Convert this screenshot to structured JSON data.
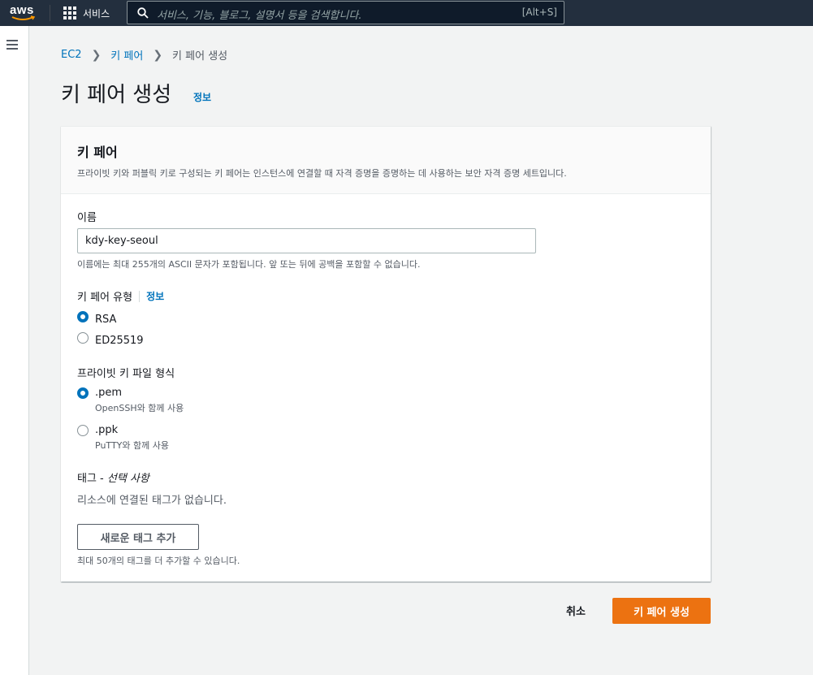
{
  "nav": {
    "logo": "aws",
    "services_label": "서비스",
    "search_placeholder": "서비스, 기능, 블로그, 설명서 등을 검색합니다.",
    "search_shortcut": "[Alt+S]"
  },
  "breadcrumb": [
    "EC2",
    "키 페어",
    "키 페어 생성"
  ],
  "page": {
    "title": "키 페어 생성",
    "info_link": "정보"
  },
  "panel": {
    "title": "키 페어",
    "description": "프라이빗 키와 퍼블릭 키로 구성되는 키 페어는 인스턴스에 연결할 때 자격 증명을 증명하는 데 사용하는 보안 자격 증명 세트입니다."
  },
  "name_field": {
    "label": "이름",
    "value": "kdy-key-seoul",
    "help": "이름에는 최대 255개의 ASCII 문자가 포함됩니다. 앞 또는 뒤에 공백을 포함할 수 없습니다."
  },
  "key_type": {
    "label": "키 페어 유형",
    "info_link": "정보",
    "options": [
      {
        "label": "RSA",
        "selected": true
      },
      {
        "label": "ED25519",
        "selected": false
      }
    ]
  },
  "file_format": {
    "label": "프라이빗 키 파일 형식",
    "options": [
      {
        "label": ".pem",
        "sub": "OpenSSH와 함께 사용",
        "selected": true
      },
      {
        "label": ".ppk",
        "sub": "PuTTY와 함께 사용",
        "selected": false
      }
    ]
  },
  "tags": {
    "label": "태그 - ",
    "optional": "선택 사항",
    "empty": "리소스에 연결된 태그가 없습니다.",
    "add_button": "새로운 태그 추가",
    "limit_help": "최대 50개의 태그를 더 추가할 수 있습니다."
  },
  "actions": {
    "cancel": "취소",
    "create": "키 페어 생성"
  },
  "colors": {
    "nav_bg": "#232f3e",
    "link": "#0073bb",
    "primary_button": "#ec7211"
  }
}
